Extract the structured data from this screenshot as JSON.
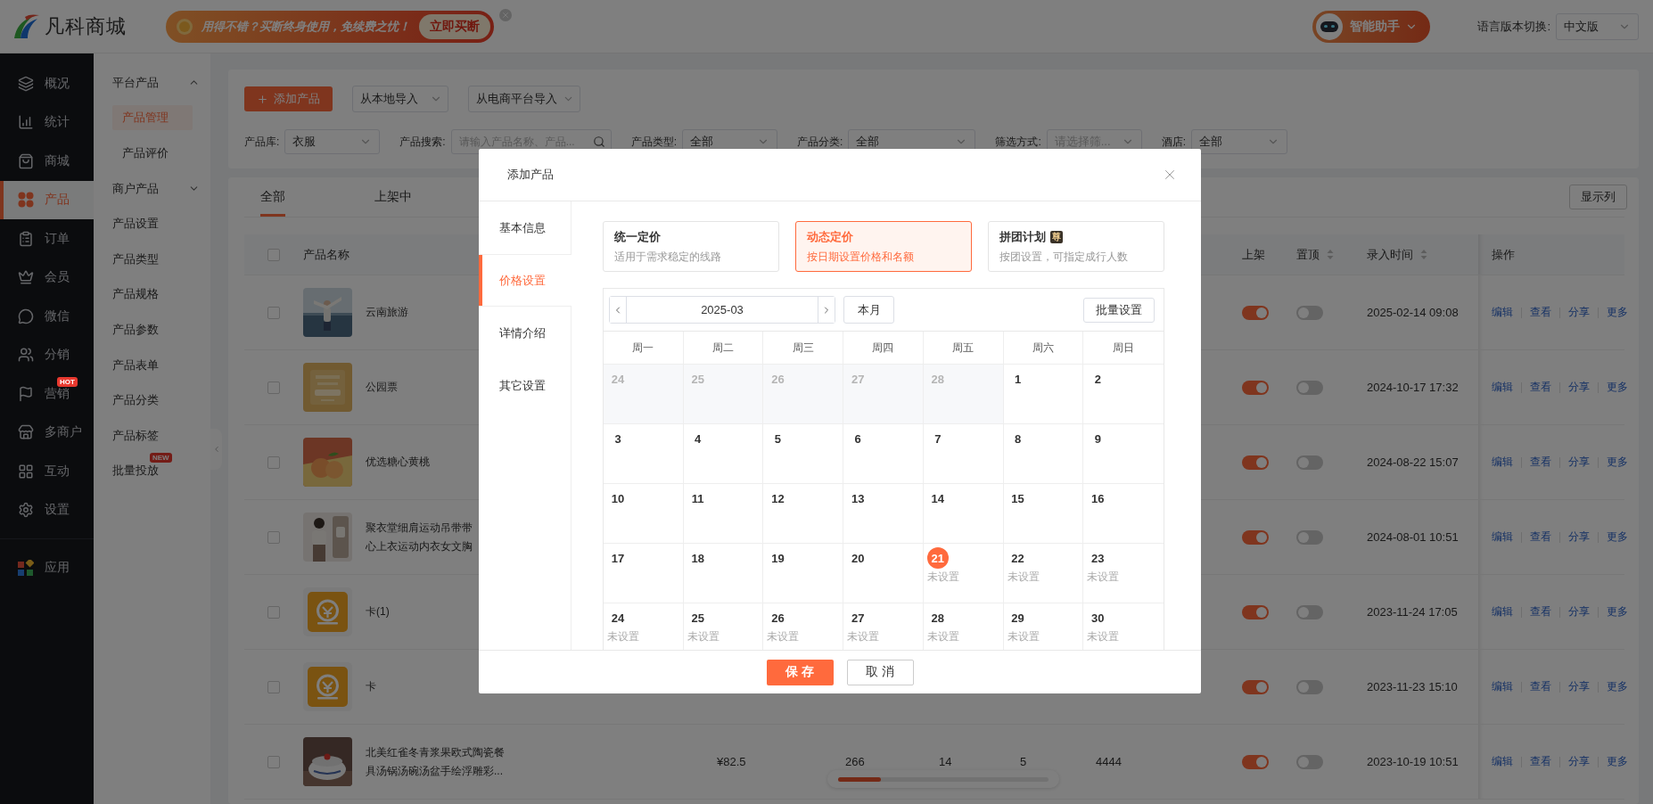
{
  "header": {
    "logo": "凡科商城",
    "promo": {
      "text": "用得不错？买断终身使用，免续费之忧！",
      "button": "立即买断"
    },
    "assistant": "智能助手",
    "language": {
      "label": "语言版本切换:",
      "value": "中文版"
    }
  },
  "nav": {
    "main": [
      {
        "label": "概况",
        "selected": false
      },
      {
        "label": "统计",
        "selected": false
      },
      {
        "label": "商城",
        "selected": false
      },
      {
        "label": "产品",
        "selected": true
      },
      {
        "label": "订单",
        "selected": false
      },
      {
        "label": "会员",
        "selected": false
      },
      {
        "label": "微信",
        "selected": false
      },
      {
        "label": "分销",
        "selected": false
      },
      {
        "label": "营销",
        "selected": false,
        "badge": "HOT"
      },
      {
        "label": "多商户",
        "selected": false
      },
      {
        "label": "互动",
        "selected": false
      },
      {
        "label": "设置",
        "selected": false
      }
    ],
    "bottom": [
      {
        "label": "应用",
        "selected": false
      }
    ]
  },
  "subnav": {
    "groups": [
      {
        "label": "平台产品",
        "expanded": true,
        "children": [
          {
            "label": "产品管理",
            "selected": true
          },
          {
            "label": "产品评价",
            "selected": false
          }
        ]
      },
      {
        "label": "商户产品",
        "expanded": false
      }
    ],
    "items": [
      {
        "label": "产品设置",
        "selected": false
      },
      {
        "label": "产品类型",
        "selected": false
      },
      {
        "label": "产品规格",
        "selected": false
      },
      {
        "label": "产品参数",
        "selected": false
      },
      {
        "label": "产品表单",
        "selected": false
      },
      {
        "label": "产品分类",
        "selected": false
      },
      {
        "label": "产品标签",
        "selected": false
      },
      {
        "label": "批量投放",
        "selected": false,
        "badge": "NEW"
      }
    ]
  },
  "toolbar": {
    "add_button": "添加产品",
    "import_buttons": [
      "从本地导入",
      "从电商平台导入"
    ],
    "filters": [
      {
        "label": "产品库:",
        "kind": "select",
        "value": "衣服"
      },
      {
        "label": "产品搜索:",
        "kind": "search",
        "placeholder": "请输入产品名称、产品..."
      },
      {
        "label": "产品类型:",
        "kind": "select",
        "value": "全部"
      },
      {
        "label": "产品分类:",
        "kind": "select",
        "value": "全部"
      },
      {
        "label": "筛选方式:",
        "kind": "select",
        "placeholder": "请选择筛..."
      },
      {
        "label": "酒店:",
        "kind": "select",
        "value": "全部"
      }
    ]
  },
  "table": {
    "tabs": [
      {
        "label": "全部",
        "selected": true
      },
      {
        "label": "上架中",
        "selected": false
      }
    ],
    "columns_button": "显示列",
    "all_checked": false,
    "header": {
      "name": "产品名称",
      "listed": "上架",
      "pinned": "置顶",
      "created": "录入时间",
      "actions": "操作"
    },
    "rows": [
      {
        "checked": false,
        "thumb": {
          "kind": "picture"
        },
        "name": "云南旅游",
        "listed": true,
        "pinned": false,
        "created": "2025-02-14 09:08",
        "actions": [
          "编辑",
          "查看",
          "分享",
          "更多"
        ]
      },
      {
        "checked": false,
        "thumb": {
          "kind": "picture"
        },
        "name": "公园票",
        "listed": true,
        "pinned": false,
        "created": "2024-10-17 17:32",
        "actions": [
          "编辑",
          "查看",
          "分享",
          "更多"
        ]
      },
      {
        "checked": false,
        "thumb": {
          "kind": "picture"
        },
        "name": "优选糖心黄桃",
        "listed": true,
        "pinned": false,
        "created": "2024-08-22 15:07",
        "actions": [
          "编辑",
          "查看",
          "分享",
          "更多"
        ]
      },
      {
        "checked": false,
        "thumb": {
          "kind": "picture"
        },
        "name": "聚衣堂细肩运动吊带带心上衣运动内衣女文胸",
        "listed": true,
        "pinned": false,
        "created": "2024-08-01 10:51",
        "actions": [
          "编辑",
          "查看",
          "分享",
          "更多"
        ]
      },
      {
        "checked": false,
        "thumb": {
          "kind": "icon"
        },
        "name": "卡(1)",
        "listed": true,
        "pinned": false,
        "created": "2023-11-24 17:05",
        "actions": [
          "编辑",
          "查看",
          "分享",
          "更多"
        ]
      },
      {
        "checked": false,
        "thumb": {
          "kind": "icon"
        },
        "name": "卡",
        "listed": true,
        "pinned": false,
        "created": "2023-11-23 15:10",
        "actions": [
          "编辑",
          "查看",
          "分享",
          "更多"
        ]
      },
      {
        "checked": false,
        "thumb": {
          "kind": "picture"
        },
        "name": "北美红雀冬青浆果欧式陶瓷餐具汤锅汤碗汤盆手绘浮雕彩...",
        "middle_cells": [
          "¥82.5",
          "266",
          "14",
          "5",
          "4444"
        ],
        "listed": true,
        "pinned": false,
        "created": "2023-10-19 10:51",
        "actions": [
          "编辑",
          "查看",
          "分享",
          "更多"
        ]
      }
    ]
  },
  "modal": {
    "title": "添加产品",
    "tabs": [
      {
        "label": "基本信息",
        "selected": false
      },
      {
        "label": "价格设置",
        "selected": true
      },
      {
        "label": "详情介绍",
        "selected": false
      },
      {
        "label": "其它设置",
        "selected": false
      }
    ],
    "pricing_modes": [
      {
        "title": "统一定价",
        "desc": "适用于需求稳定的线路",
        "selected": false
      },
      {
        "title": "动态定价",
        "desc": "按日期设置价格和名额",
        "selected": true
      },
      {
        "title": "拼团计划",
        "badge": "尊",
        "desc": "按团设置，可指定成行人数",
        "selected": false
      }
    ],
    "calendar": {
      "month": "2025-03",
      "today_button": "本月",
      "batch_button": "批量设置",
      "weekdays": [
        "周一",
        "周二",
        "周三",
        "周四",
        "周五",
        "周六",
        "周日"
      ],
      "weeks": [
        [
          {
            "day": "24",
            "muted": true,
            "today": false
          },
          {
            "day": "25",
            "muted": true,
            "today": false
          },
          {
            "day": "26",
            "muted": true,
            "today": false
          },
          {
            "day": "27",
            "muted": true,
            "today": false
          },
          {
            "day": "28",
            "muted": true,
            "today": false
          },
          {
            "day": "1",
            "muted": false,
            "today": false
          },
          {
            "day": "2",
            "muted": false,
            "today": false
          }
        ],
        [
          {
            "day": "3",
            "muted": false,
            "today": false
          },
          {
            "day": "4",
            "muted": false,
            "today": false
          },
          {
            "day": "5",
            "muted": false,
            "today": false
          },
          {
            "day": "6",
            "muted": false,
            "today": false
          },
          {
            "day": "7",
            "muted": false,
            "today": false
          },
          {
            "day": "8",
            "muted": false,
            "today": false
          },
          {
            "day": "9",
            "muted": false,
            "today": false
          }
        ],
        [
          {
            "day": "10",
            "muted": false,
            "today": false
          },
          {
            "day": "11",
            "muted": false,
            "today": false
          },
          {
            "day": "12",
            "muted": false,
            "today": false
          },
          {
            "day": "13",
            "muted": false,
            "today": false
          },
          {
            "day": "14",
            "muted": false,
            "today": false
          },
          {
            "day": "15",
            "muted": false,
            "today": false
          },
          {
            "day": "16",
            "muted": false,
            "today": false
          }
        ],
        [
          {
            "day": "17",
            "muted": false,
            "today": false
          },
          {
            "day": "18",
            "muted": false,
            "today": false
          },
          {
            "day": "19",
            "muted": false,
            "today": false
          },
          {
            "day": "20",
            "muted": false,
            "today": false
          },
          {
            "day": "21",
            "muted": false,
            "today": true,
            "status": "未设置"
          },
          {
            "day": "22",
            "muted": false,
            "today": false,
            "status": "未设置"
          },
          {
            "day": "23",
            "muted": false,
            "today": false,
            "status": "未设置"
          }
        ],
        [
          {
            "day": "24",
            "muted": false,
            "today": false,
            "status": "未设置"
          },
          {
            "day": "25",
            "muted": false,
            "today": false,
            "status": "未设置"
          },
          {
            "day": "26",
            "muted": false,
            "today": false,
            "status": "未设置"
          },
          {
            "day": "27",
            "muted": false,
            "today": false,
            "status": "未设置"
          },
          {
            "day": "28",
            "muted": false,
            "today": false,
            "status": "未设置"
          },
          {
            "day": "29",
            "muted": false,
            "today": false,
            "status": "未设置"
          },
          {
            "day": "30",
            "muted": false,
            "today": false,
            "status": "未设置"
          }
        ]
      ]
    },
    "buttons": {
      "save": "保 存",
      "cancel": "取 消"
    }
  }
}
